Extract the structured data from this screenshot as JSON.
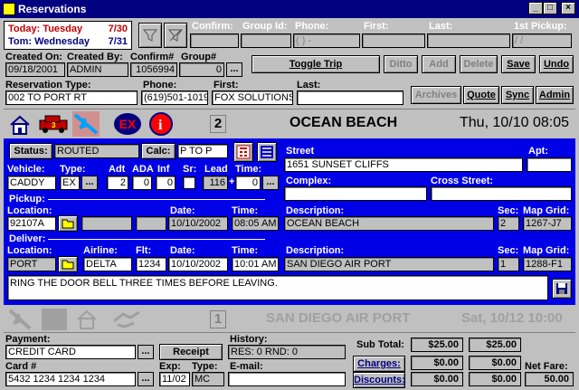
{
  "window": {
    "title": "Reservations",
    "min": "_",
    "max": "□",
    "close": "×"
  },
  "dates": {
    "today_label": "Today: Tuesday",
    "today_date": "7/30",
    "tom_label": "Tom: Wednesday",
    "tom_date": "7/31"
  },
  "search": {
    "confirm_label": "Confirm:",
    "group_label": "Group Id:",
    "phone_label": "Phone:",
    "first_label": "First:",
    "last_label": "Last:",
    "pickup_label": "1st Pickup:",
    "phone_value": "(  )  -",
    "pickup_value": "/  /"
  },
  "created": {
    "on_label": "Created On:",
    "by_label": "Created By:",
    "confirm_label": "Confirm#",
    "group_label": "Group#",
    "on_value": "09/18/2001",
    "by_value": "ADMIN",
    "confirm_value": "1056994",
    "group_value": "0"
  },
  "toolbar": {
    "toggle": "Toggle Trip",
    "ditto": "Ditto",
    "add": "Add",
    "delete": "Delete",
    "save": "Save",
    "undo": "Undo",
    "archives": "Archives",
    "quote": "Quote",
    "sync": "Sync",
    "admin": "Admin"
  },
  "reservation": {
    "type_label": "Reservation Type:",
    "type_value": "002 TO PORT RT",
    "phone_label": "Phone:",
    "phone_value": "(619)501-1019",
    "first_label": "First:",
    "first_value": "FOX SOLUTIONS",
    "last_label": "Last:",
    "last_value": ""
  },
  "trip1": {
    "number": "2",
    "destination": "OCEAN BEACH",
    "datetime": "Thu, 10/10 08:05",
    "ex_icon": "EX"
  },
  "trip": {
    "status_label": "Status:",
    "status_value": "ROUTED",
    "calc_label": "Calc:",
    "calc_value": "P TO P",
    "street_label": "Street",
    "street_value": "1651 SUNSET CLIFFS",
    "apt_label": "Apt:",
    "apt_value": "",
    "vehicle_label": "Vehicle:",
    "vehicle_value": "CADDY",
    "type_label": "Type:",
    "type_value": "EX",
    "adt_label": "Adt",
    "adt_value": "2",
    "ada_label": "ADA",
    "ada_value": "0",
    "inf_label": "Inf",
    "inf_value": "0",
    "sr_label": "Sr:",
    "lead_label": "Lead",
    "lead_value": "116",
    "plus": "+",
    "time_label": "Time:",
    "time_value": "0",
    "complex_label": "Complex:",
    "cross_label": "Cross Street:"
  },
  "pickup": {
    "header": "Pickup:",
    "location_label": "Location:",
    "location_value": "92107A",
    "date_label": "Date:",
    "date_value": "10/10/2002",
    "time_label": "Time:",
    "time_value": "08:05 AM",
    "desc_label": "Description:",
    "desc_value": "OCEAN BEACH",
    "sec_label": "Sec:",
    "sec_value": "2",
    "map_label": "Map Grid:",
    "map_value": "1267-J7"
  },
  "deliver": {
    "header": "Deliver:",
    "location_label": "Location:",
    "location_value": "PORT",
    "airline_label": "Airline:",
    "airline_value": "DELTA",
    "flt_label": "Flt:",
    "flt_value": "1234",
    "date_label": "Date:",
    "date_value": "10/10/2002",
    "time_label": "Time:",
    "time_value": "10:01 AM",
    "desc_label": "Description:",
    "desc_value": "SAN DIEGO AIR PORT",
    "sec_label": "Sec:",
    "sec_value": "1",
    "map_label": "Map Grid:",
    "map_value": "1288-F1"
  },
  "note": "RING THE DOOR BELL THREE TIMES BEFORE LEAVING.",
  "trip2": {
    "number": "1",
    "destination": "SAN DIEGO AIR PORT",
    "datetime": "Sat, 10/12  10:00"
  },
  "payment": {
    "label": "Payment:",
    "value": "CREDIT CARD",
    "receipt": "Receipt",
    "card_label": "Card #",
    "card_value": "5432 1234 1234 1234",
    "exp_label": "Exp:",
    "exp_value": "11/02",
    "type_label": "Type:",
    "type_value": "MC",
    "email_label": "E-mail:",
    "history_label": "History:",
    "history_value": "RES: 0  RND: 0"
  },
  "totals": {
    "subtotal_label": "Sub Total:",
    "subtotal1": "$25.00",
    "subtotal2": "$25.00",
    "charges_label": "Charges:",
    "charges1": "$0.00",
    "charges2": "$0.00",
    "discounts_label": "Discounts:",
    "discounts1": "$0.00",
    "discounts2": "$0.00",
    "netfare_label": "Net Fare:",
    "netfare_value": "50.00"
  },
  "dots": "..."
}
